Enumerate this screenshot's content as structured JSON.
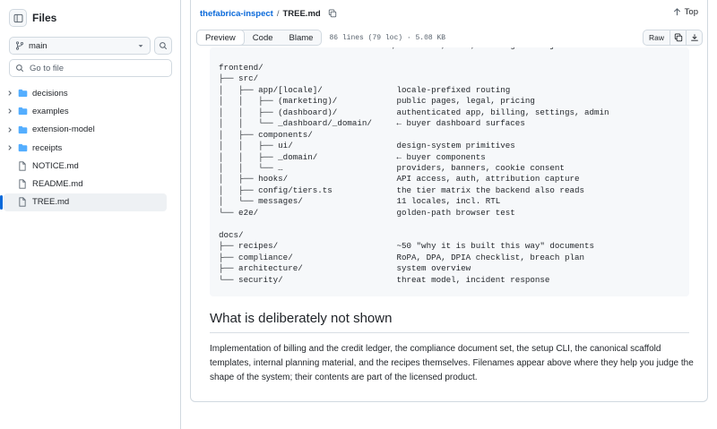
{
  "sidebar": {
    "title": "Files",
    "branch": "main",
    "search_placeholder": "Go to file",
    "items": [
      {
        "label": "decisions",
        "type": "folder"
      },
      {
        "label": "examples",
        "type": "folder"
      },
      {
        "label": "extension-model",
        "type": "folder"
      },
      {
        "label": "receipts",
        "type": "folder"
      },
      {
        "label": "NOTICE.md",
        "type": "file"
      },
      {
        "label": "README.md",
        "type": "file"
      },
      {
        "label": "TREE.md",
        "type": "file",
        "active": true
      }
    ]
  },
  "header": {
    "repo": "thefabrica-inspect",
    "separator": "/",
    "file": "TREE.md",
    "top_label": "Top"
  },
  "toolbar": {
    "tabs": [
      "Preview",
      "Code",
      "Blame"
    ],
    "meta": "86 lines (79 loc) · 5.08 KB",
    "raw_label": "Raw"
  },
  "content": {
    "code_text": "   └── …                       auth, webhooks, cron, abusing all objects\n\nfrontend/\n├── src/\n│   ├── app/[locale]/               locale-prefixed routing\n│   │   ├── (marketing)/            public pages, legal, pricing\n│   │   ├── (dashboard)/            authenticated app, billing, settings, admin\n│   │   └── _dashboard/_domain/     ← buyer dashboard surfaces\n│   ├── components/\n│   │   ├── ui/                     design-system primitives\n│   │   ├── _domain/                ← buyer components\n│   │   └── …                       providers, banners, cookie consent\n│   ├── hooks/                      API access, auth, attribution capture\n│   ├── config/tiers.ts             the tier matrix the backend also reads\n│   └── messages/                   11 locales, incl. RTL\n└── e2e/                            golden-path browser test\n\ndocs/\n├── recipes/                        ~50 \"why it is built this way\" documents\n├── compliance/                     RoPA, DPA, DPIA checklist, breach plan\n├── architecture/                   system overview\n└── security/                       threat model, incident response",
    "heading": "What is deliberately not shown",
    "paragraph": "Implementation of billing and the credit ledger, the compliance document set, the setup CLI, the canonical scaffold templates, internal planning material, and the recipes themselves. Filenames appear above where they help you judge the shape of the system; their contents are part of the licensed product."
  },
  "colors": {
    "accent": "#0969da",
    "folder": "#54aeff",
    "border": "#d1d9e0",
    "code_bg": "#f6f8fa"
  }
}
